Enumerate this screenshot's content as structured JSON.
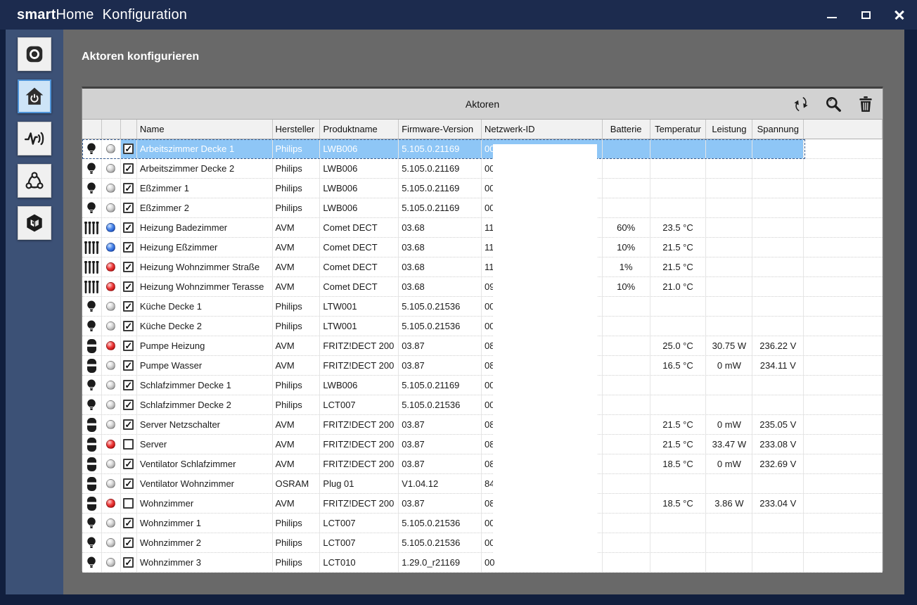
{
  "window": {
    "title_bold": "smart",
    "title_rest": "Home",
    "title_app": "Konfiguration",
    "controls": [
      "minimize-icon",
      "maximize-icon",
      "close-icon"
    ]
  },
  "sidebar": {
    "items": [
      {
        "icon": "webcam-icon",
        "active": false
      },
      {
        "icon": "home-power-icon",
        "active": true
      },
      {
        "icon": "sensor-pulse-icon",
        "active": false
      },
      {
        "icon": "network-share-icon",
        "active": false
      },
      {
        "icon": "cube-logo-icon",
        "active": false
      }
    ]
  },
  "main": {
    "heading": "Aktoren konfigurieren",
    "table": {
      "title": "Aktoren",
      "toolbar_icons": [
        "refresh-icon",
        "search-icon",
        "trash-icon"
      ],
      "columns": [
        "Name",
        "Hersteller",
        "Produktname",
        "Firmware-Version",
        "Netzwerk-ID",
        "Batterie",
        "Temperatur",
        "Leistung",
        "Spannung"
      ],
      "netzwerk_id_redacted": true,
      "rows": [
        {
          "icon": "bulb",
          "status": "gray",
          "checked": true,
          "selected": true,
          "name": "Arbeitszimmer Decke 1",
          "manufacturer": "Philips",
          "product": "LWB006",
          "firmware": "5.105.0.21169",
          "network": "00:17:88:01",
          "battery": "",
          "temperature": "",
          "power": "",
          "voltage": ""
        },
        {
          "icon": "bulb",
          "status": "gray",
          "checked": true,
          "selected": false,
          "name": "Arbeitszimmer Decke 2",
          "manufacturer": "Philips",
          "product": "LWB006",
          "firmware": "5.105.0.21169",
          "network": "00",
          "battery": "",
          "temperature": "",
          "power": "",
          "voltage": ""
        },
        {
          "icon": "bulb",
          "status": "gray",
          "checked": true,
          "selected": false,
          "name": "Eßzimmer 1",
          "manufacturer": "Philips",
          "product": "LWB006",
          "firmware": "5.105.0.21169",
          "network": "00",
          "battery": "",
          "temperature": "",
          "power": "",
          "voltage": ""
        },
        {
          "icon": "bulb",
          "status": "gray",
          "checked": true,
          "selected": false,
          "name": "Eßzimmer 2",
          "manufacturer": "Philips",
          "product": "LWB006",
          "firmware": "5.105.0.21169",
          "network": "00",
          "battery": "",
          "temperature": "",
          "power": "",
          "voltage": ""
        },
        {
          "icon": "radiator",
          "status": "blue",
          "checked": true,
          "selected": false,
          "name": "Heizung Badezimmer",
          "manufacturer": "AVM",
          "product": "Comet DECT",
          "firmware": "03.68",
          "network": "11",
          "battery": "60%",
          "temperature": "23.5 °C",
          "power": "",
          "voltage": ""
        },
        {
          "icon": "radiator",
          "status": "blue",
          "checked": true,
          "selected": false,
          "name": "Heizung Eßzimmer",
          "manufacturer": "AVM",
          "product": "Comet DECT",
          "firmware": "03.68",
          "network": "11",
          "battery": "10%",
          "temperature": "21.5 °C",
          "power": "",
          "voltage": ""
        },
        {
          "icon": "radiator",
          "status": "red",
          "checked": true,
          "selected": false,
          "name": "Heizung Wohnzimmer Straße",
          "manufacturer": "AVM",
          "product": "Comet DECT",
          "firmware": "03.68",
          "network": "11",
          "battery": "1%",
          "temperature": "21.5 °C",
          "power": "",
          "voltage": ""
        },
        {
          "icon": "radiator",
          "status": "red",
          "checked": true,
          "selected": false,
          "name": "Heizung Wohnzimmer Terasse",
          "manufacturer": "AVM",
          "product": "Comet DECT",
          "firmware": "03.68",
          "network": "09",
          "battery": "10%",
          "temperature": "21.0 °C",
          "power": "",
          "voltage": ""
        },
        {
          "icon": "bulb",
          "status": "gray",
          "checked": true,
          "selected": false,
          "name": "Küche Decke 1",
          "manufacturer": "Philips",
          "product": "LTW001",
          "firmware": "5.105.0.21536",
          "network": "00",
          "battery": "",
          "temperature": "",
          "power": "",
          "voltage": ""
        },
        {
          "icon": "bulb",
          "status": "gray",
          "checked": true,
          "selected": false,
          "name": "Küche Decke 2",
          "manufacturer": "Philips",
          "product": "LTW001",
          "firmware": "5.105.0.21536",
          "network": "00",
          "battery": "",
          "temperature": "",
          "power": "",
          "voltage": ""
        },
        {
          "icon": "plug",
          "status": "red",
          "checked": true,
          "selected": false,
          "name": "Pumpe Heizung",
          "manufacturer": "AVM",
          "product": "FRITZ!DECT 200",
          "firmware": "03.87",
          "network": "08",
          "battery": "",
          "temperature": "25.0 °C",
          "power": "30.75 W",
          "voltage": "236.22 V"
        },
        {
          "icon": "plug",
          "status": "gray",
          "checked": true,
          "selected": false,
          "name": "Pumpe Wasser",
          "manufacturer": "AVM",
          "product": "FRITZ!DECT 200",
          "firmware": "03.87",
          "network": "08",
          "battery": "",
          "temperature": "16.5 °C",
          "power": "0 mW",
          "voltage": "234.11 V"
        },
        {
          "icon": "bulb",
          "status": "gray",
          "checked": true,
          "selected": false,
          "name": "Schlafzimmer Decke 1",
          "manufacturer": "Philips",
          "product": "LWB006",
          "firmware": "5.105.0.21169",
          "network": "00",
          "battery": "",
          "temperature": "",
          "power": "",
          "voltage": ""
        },
        {
          "icon": "bulb",
          "status": "gray",
          "checked": true,
          "selected": false,
          "name": "Schlafzimmer Decke 2",
          "manufacturer": "Philips",
          "product": "LCT007",
          "firmware": "5.105.0.21536",
          "network": "00",
          "battery": "",
          "temperature": "",
          "power": "",
          "voltage": ""
        },
        {
          "icon": "plug",
          "status": "gray",
          "checked": true,
          "selected": false,
          "name": "Server Netzschalter",
          "manufacturer": "AVM",
          "product": "FRITZ!DECT 200",
          "firmware": "03.87",
          "network": "08",
          "battery": "",
          "temperature": "21.5 °C",
          "power": "0 mW",
          "voltage": "235.05 V"
        },
        {
          "icon": "plug",
          "status": "red",
          "checked": false,
          "selected": false,
          "name": "Server",
          "manufacturer": "AVM",
          "product": "FRITZ!DECT 200",
          "firmware": "03.87",
          "network": "08",
          "battery": "",
          "temperature": "21.5 °C",
          "power": "33.47 W",
          "voltage": "233.08 V"
        },
        {
          "icon": "plug",
          "status": "gray",
          "checked": true,
          "selected": false,
          "name": "Ventilator Schlafzimmer",
          "manufacturer": "AVM",
          "product": "FRITZ!DECT 200",
          "firmware": "03.87",
          "network": "08",
          "battery": "",
          "temperature": "18.5 °C",
          "power": "0 mW",
          "voltage": "232.69 V"
        },
        {
          "icon": "plug",
          "status": "gray",
          "checked": true,
          "selected": false,
          "name": "Ventilator Wohnzimmer",
          "manufacturer": "OSRAM",
          "product": "Plug 01",
          "firmware": "V1.04.12",
          "network": "84",
          "battery": "",
          "temperature": "",
          "power": "",
          "voltage": ""
        },
        {
          "icon": "plug",
          "status": "red",
          "checked": false,
          "selected": false,
          "name": "Wohnzimmer",
          "manufacturer": "AVM",
          "product": "FRITZ!DECT 200",
          "firmware": "03.87",
          "network": "08",
          "battery": "",
          "temperature": "18.5 °C",
          "power": "3.86 W",
          "voltage": "233.04 V"
        },
        {
          "icon": "bulb",
          "status": "gray",
          "checked": true,
          "selected": false,
          "name": "Wohnzimmer 1",
          "manufacturer": "Philips",
          "product": "LCT007",
          "firmware": "5.105.0.21536",
          "network": "00",
          "battery": "",
          "temperature": "",
          "power": "",
          "voltage": ""
        },
        {
          "icon": "bulb",
          "status": "gray",
          "checked": true,
          "selected": false,
          "name": "Wohnzimmer 2",
          "manufacturer": "Philips",
          "product": "LCT007",
          "firmware": "5.105.0.21536",
          "network": "00",
          "battery": "",
          "temperature": "",
          "power": "",
          "voltage": ""
        },
        {
          "icon": "bulb",
          "status": "gray",
          "checked": true,
          "selected": false,
          "name": "Wohnzimmer 3",
          "manufacturer": "Philips",
          "product": "LCT010",
          "firmware": "1.29.0_r21169",
          "network": "00",
          "battery": "",
          "temperature": "",
          "power": "",
          "voltage": ""
        }
      ]
    }
  },
  "colors": {
    "titlebar": "#1c2b4e",
    "frame": "#111f3e",
    "sidebar": "#3c5176",
    "main_background": "#696969",
    "band": "#d2d2d2",
    "selection": "#8ec6f6",
    "sidebar_active": "#cde4f7",
    "status_blue": "#1c4fc4",
    "status_red": "#cc1111",
    "status_gray": "#a2a2a2"
  }
}
